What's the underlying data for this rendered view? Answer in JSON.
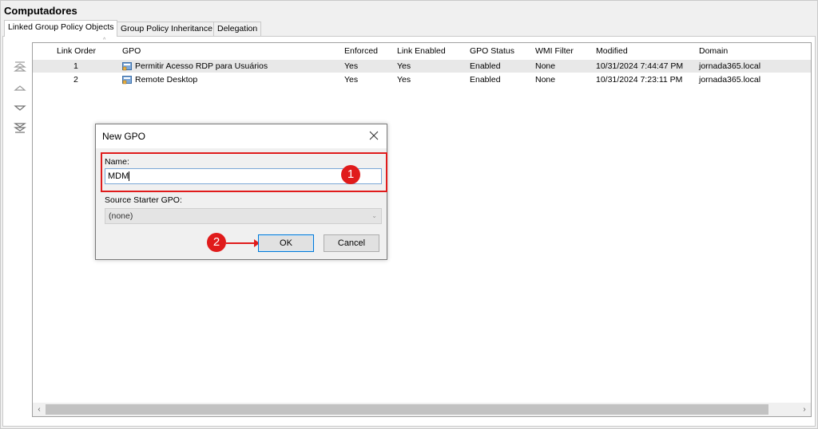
{
  "page": {
    "title": "Computadores"
  },
  "tabs": [
    {
      "label": "Linked Group Policy Objects",
      "active": true
    },
    {
      "label": "Group Policy Inheritance",
      "active": false
    },
    {
      "label": "Delegation",
      "active": false
    }
  ],
  "table": {
    "columns": [
      "Link Order",
      "GPO",
      "Enforced",
      "Link Enabled",
      "GPO Status",
      "WMI Filter",
      "Modified",
      "Domain"
    ],
    "rows": [
      {
        "link_order": "1",
        "gpo": "Permitir Acesso RDP para Usuários",
        "enforced": "Yes",
        "link_enabled": "Yes",
        "gpo_status": "Enabled",
        "wmi_filter": "None",
        "modified": "10/31/2024 7:44:47 PM",
        "domain": "jornada365.local"
      },
      {
        "link_order": "2",
        "gpo": "Remote Desktop",
        "enforced": "Yes",
        "link_enabled": "Yes",
        "gpo_status": "Enabled",
        "wmi_filter": "None",
        "modified": "10/31/2024 7:23:11 PM",
        "domain": "jornada365.local"
      }
    ]
  },
  "side_buttons": [
    "move-to-top-icon",
    "move-up-icon",
    "move-down-icon",
    "move-to-bottom-icon"
  ],
  "scrollbar": {
    "left_arrow": "‹",
    "right_arrow": "›"
  },
  "dialog": {
    "title": "New GPO",
    "name_label": "Name:",
    "name_value": "MDM",
    "source_label": "Source Starter GPO:",
    "source_value": "(none)",
    "ok_label": "OK",
    "cancel_label": "Cancel"
  },
  "annotations": {
    "step1": "1",
    "step2": "2"
  },
  "colors": {
    "highlight": "#e01b1b",
    "selection": "#e8e8e8",
    "focus": "#0078d7"
  }
}
